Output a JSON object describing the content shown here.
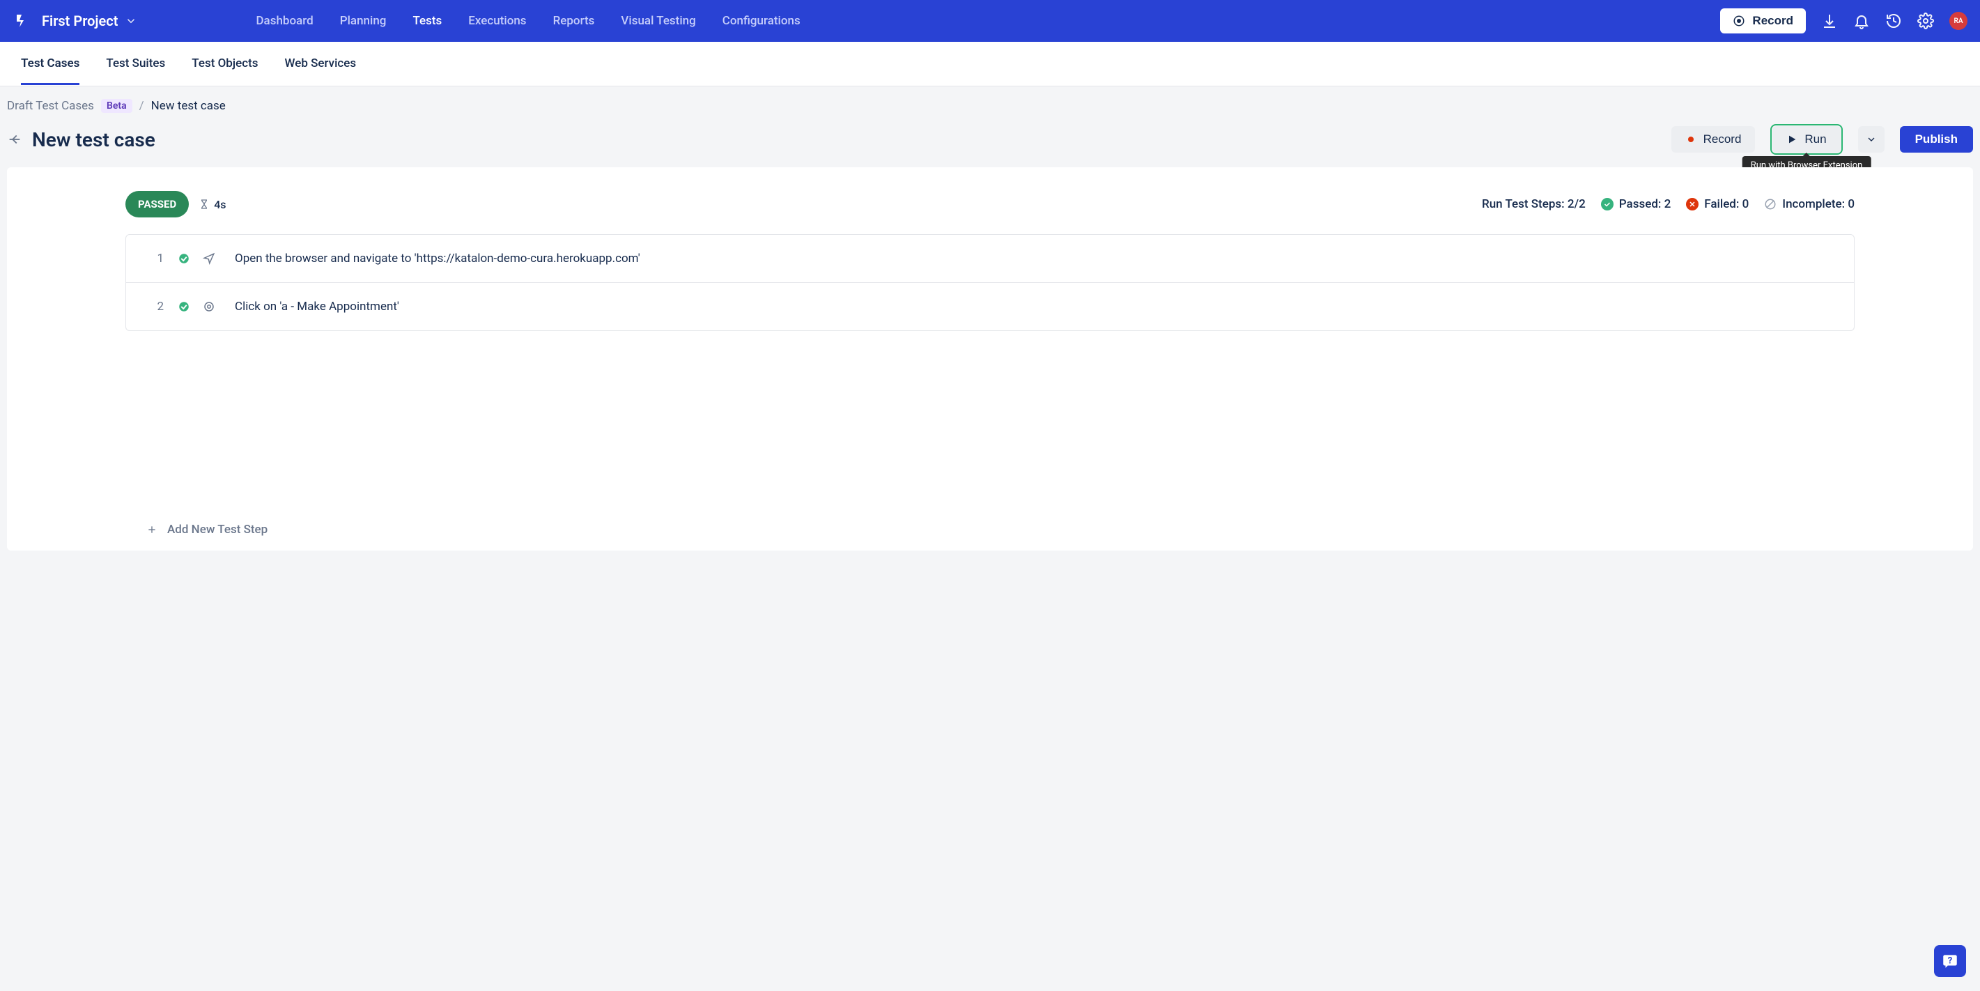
{
  "topnav": {
    "project": "First Project",
    "links": [
      "Dashboard",
      "Planning",
      "Tests",
      "Executions",
      "Reports",
      "Visual Testing",
      "Configurations"
    ],
    "active_link": "Tests",
    "record": "Record",
    "avatar_initials": "RA"
  },
  "subtabs": {
    "items": [
      "Test Cases",
      "Test Suites",
      "Test Objects",
      "Web Services"
    ],
    "active": "Test Cases"
  },
  "breadcrumb": {
    "draft": "Draft Test Cases",
    "beta": "Beta",
    "current": "New test case"
  },
  "page": {
    "title": "New test case",
    "actions": {
      "record": "Record",
      "run": "Run",
      "publish": "Publish",
      "run_tooltip": "Run with Browser Extension"
    }
  },
  "summary": {
    "status": "PASSED",
    "duration": "4s",
    "run_steps_label": "Run Test Steps: 2/2",
    "passed_label": "Passed: 2",
    "failed_label": "Failed: 0",
    "incomplete_label": "Incomplete: 0"
  },
  "steps": [
    {
      "num": "1",
      "text": "Open the browser and navigate to 'https://katalon-demo-cura.herokuapp.com'",
      "icon": "navigate"
    },
    {
      "num": "2",
      "text": "Click on 'a - Make Appointment'",
      "icon": "click"
    }
  ],
  "add_step_label": "Add New Test Step"
}
